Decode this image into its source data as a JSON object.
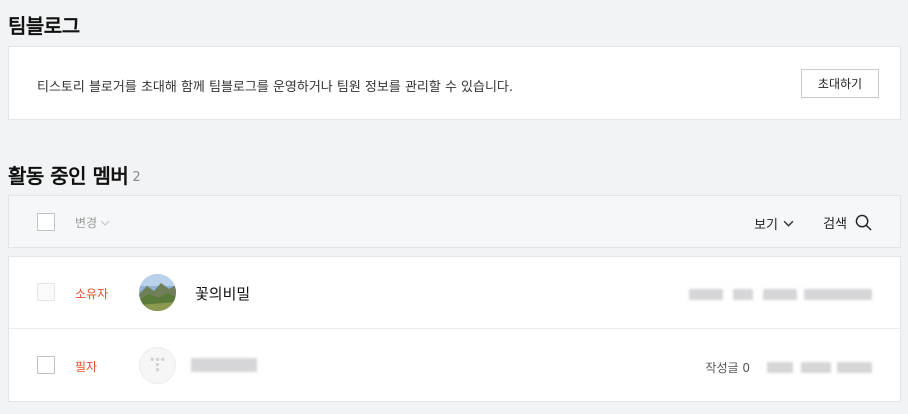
{
  "team_section": {
    "title": "팀블로그",
    "invite_text": "티스토리 블로거를 초대해 함께 팀블로그를 운영하거나 팀원 정보를 관리할 수 있습니다.",
    "invite_button": "초대하기"
  },
  "member_section": {
    "title": "활동 중인 멤버",
    "count": "2",
    "toolbar": {
      "change_label": "변경",
      "view_label": "보기",
      "search_label": "검색"
    },
    "members": [
      {
        "role": "소유자",
        "name": "꽃의비밀",
        "post_count": ""
      },
      {
        "role": "필자",
        "name": "",
        "post_count": "작성글 0"
      }
    ]
  },
  "colors": {
    "role_accent": "#e0502d",
    "background": "#f2f3f5"
  },
  "icons": [
    "chevron-down-icon",
    "search-icon",
    "tistory-default-avatar-icon"
  ]
}
